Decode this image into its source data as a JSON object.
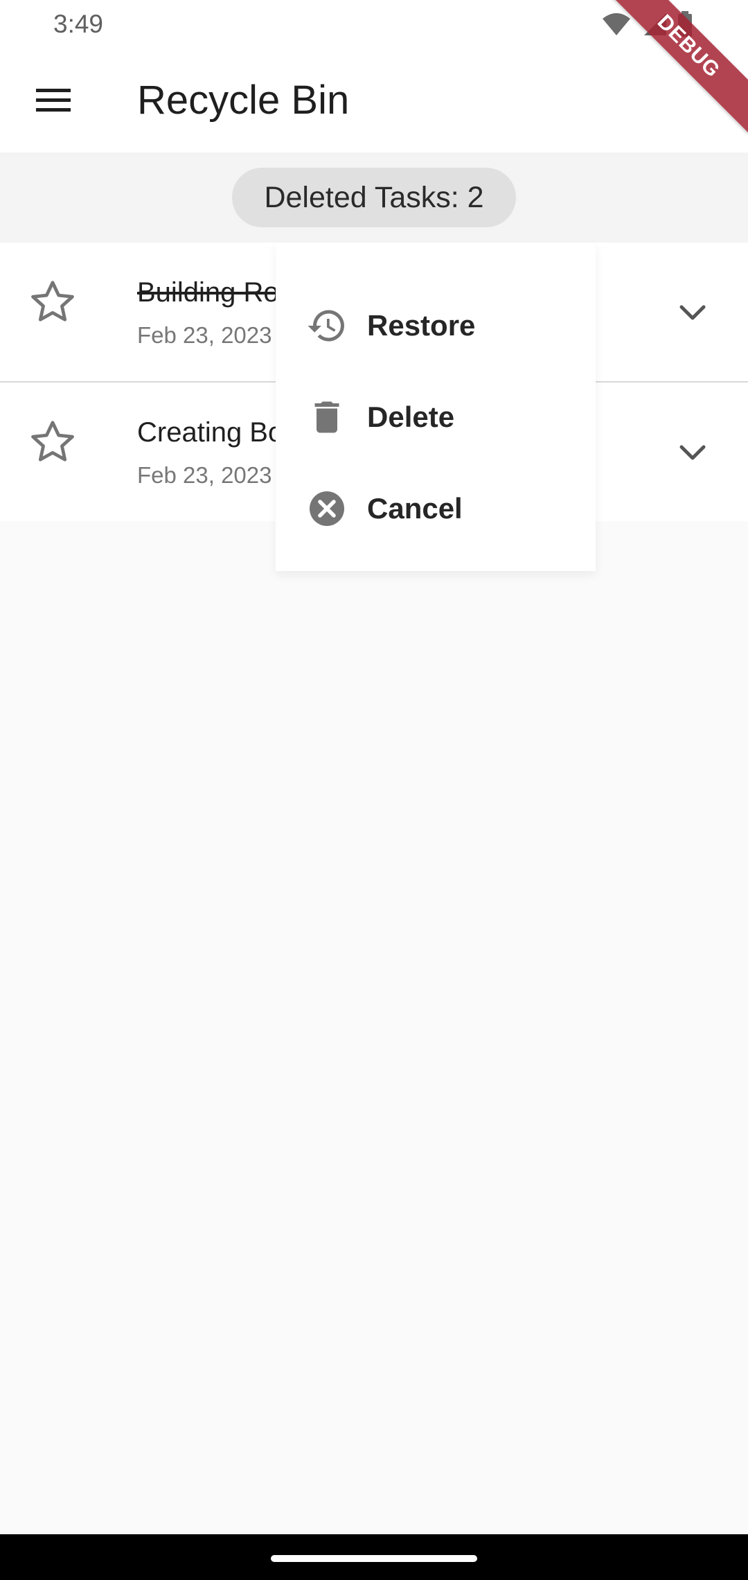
{
  "status_bar": {
    "time": "3:49"
  },
  "debug_banner": {
    "label": "DEBUG",
    "color": "#A52332"
  },
  "app_bar": {
    "title": "Recycle Bin",
    "menu_icon": "hamburger-menu-icon"
  },
  "summary_chip": {
    "label": "Deleted Tasks: 2"
  },
  "tasks": [
    {
      "title": "Building Ro",
      "date": "Feb 23, 2023",
      "completed": true,
      "favorite": false
    },
    {
      "title": "Creating Bo",
      "date": "Feb 23, 2023",
      "completed": false,
      "favorite": false
    }
  ],
  "popup_menu": {
    "items": [
      {
        "label": "Restore",
        "icon": "restore-history-icon"
      },
      {
        "label": "Delete",
        "icon": "trash-icon"
      },
      {
        "label": "Cancel",
        "icon": "cancel-circle-icon"
      }
    ]
  },
  "colors": {
    "background": "#FAFAFA",
    "surface": "#FFFFFF",
    "chip": "#E0E0E0",
    "icon_gray": "#757575"
  }
}
